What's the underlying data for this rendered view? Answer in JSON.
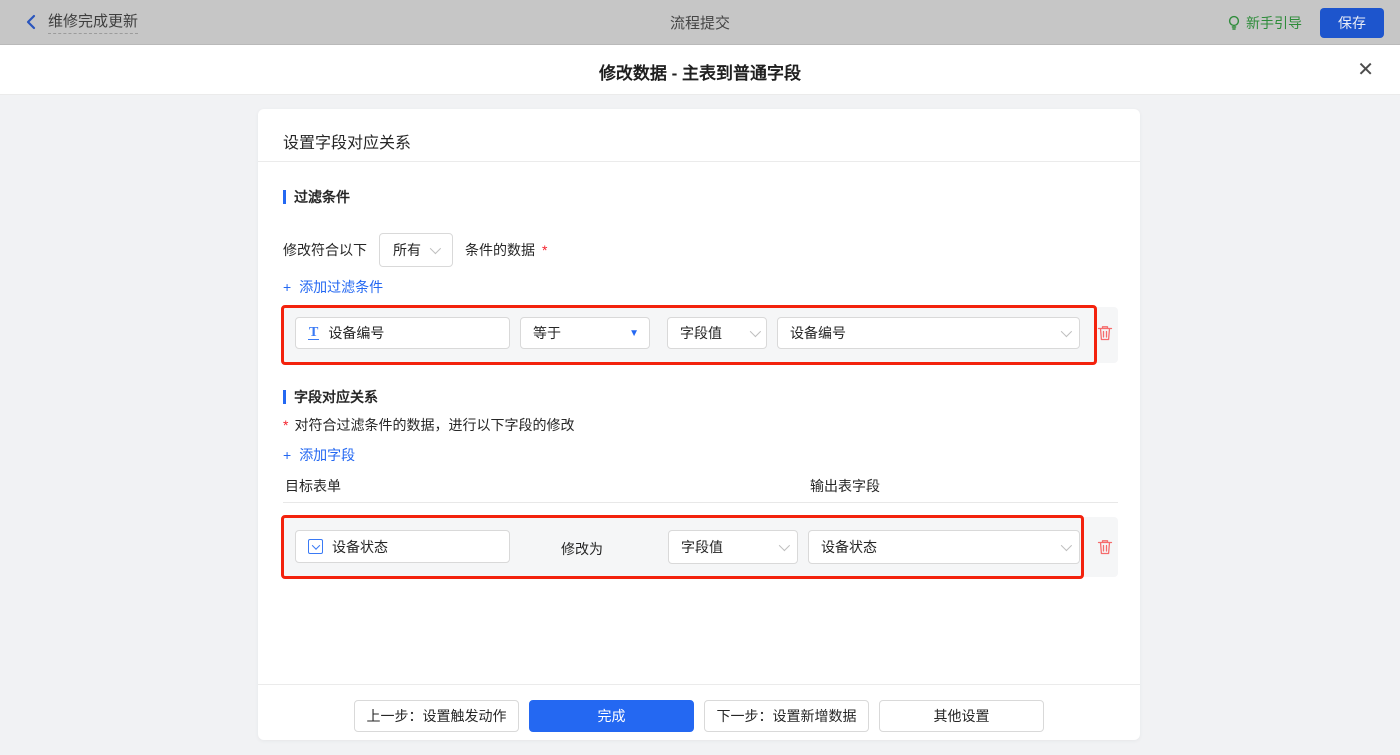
{
  "topbar": {
    "back_label": "维修完成更新",
    "center_title": "流程提交",
    "guide_label": "新手引导",
    "save_label": "保存"
  },
  "modal": {
    "title": "修改数据 - 主表到普通字段",
    "close_glyph": "✕"
  },
  "card": {
    "header": "设置字段对应关系",
    "filter_section": {
      "title": "过滤条件",
      "prefix": "修改符合以下",
      "match_select_value": "所有",
      "suffix": "条件的数据",
      "required_mark": "*",
      "add_plus": "+",
      "add_label": "添加过滤条件",
      "row": {
        "field_name": "设备编号",
        "operator": "等于",
        "value_type": "字段值",
        "value_field": "设备编号"
      }
    },
    "mapping_section": {
      "title": "字段对应关系",
      "required_mark": "*",
      "description": "对符合过滤条件的数据，进行以下字段的修改",
      "add_plus": "+",
      "add_label": "添加字段",
      "col_target": "目标表单",
      "col_output": "输出表字段",
      "row": {
        "field_name": "设备状态",
        "action_label": "修改为",
        "value_type": "字段值",
        "value_field": "设备状态"
      }
    },
    "footer": {
      "prev_label": "上一步：设置触发动作",
      "finish_label": "完成",
      "next_label": "下一步：设置新增数据",
      "other_label": "其他设置"
    }
  },
  "colors": {
    "accent_blue": "#2468f2",
    "annotation_red": "#f3220d",
    "danger_red": "#f56c6c",
    "guide_green": "#2e8c3a"
  }
}
